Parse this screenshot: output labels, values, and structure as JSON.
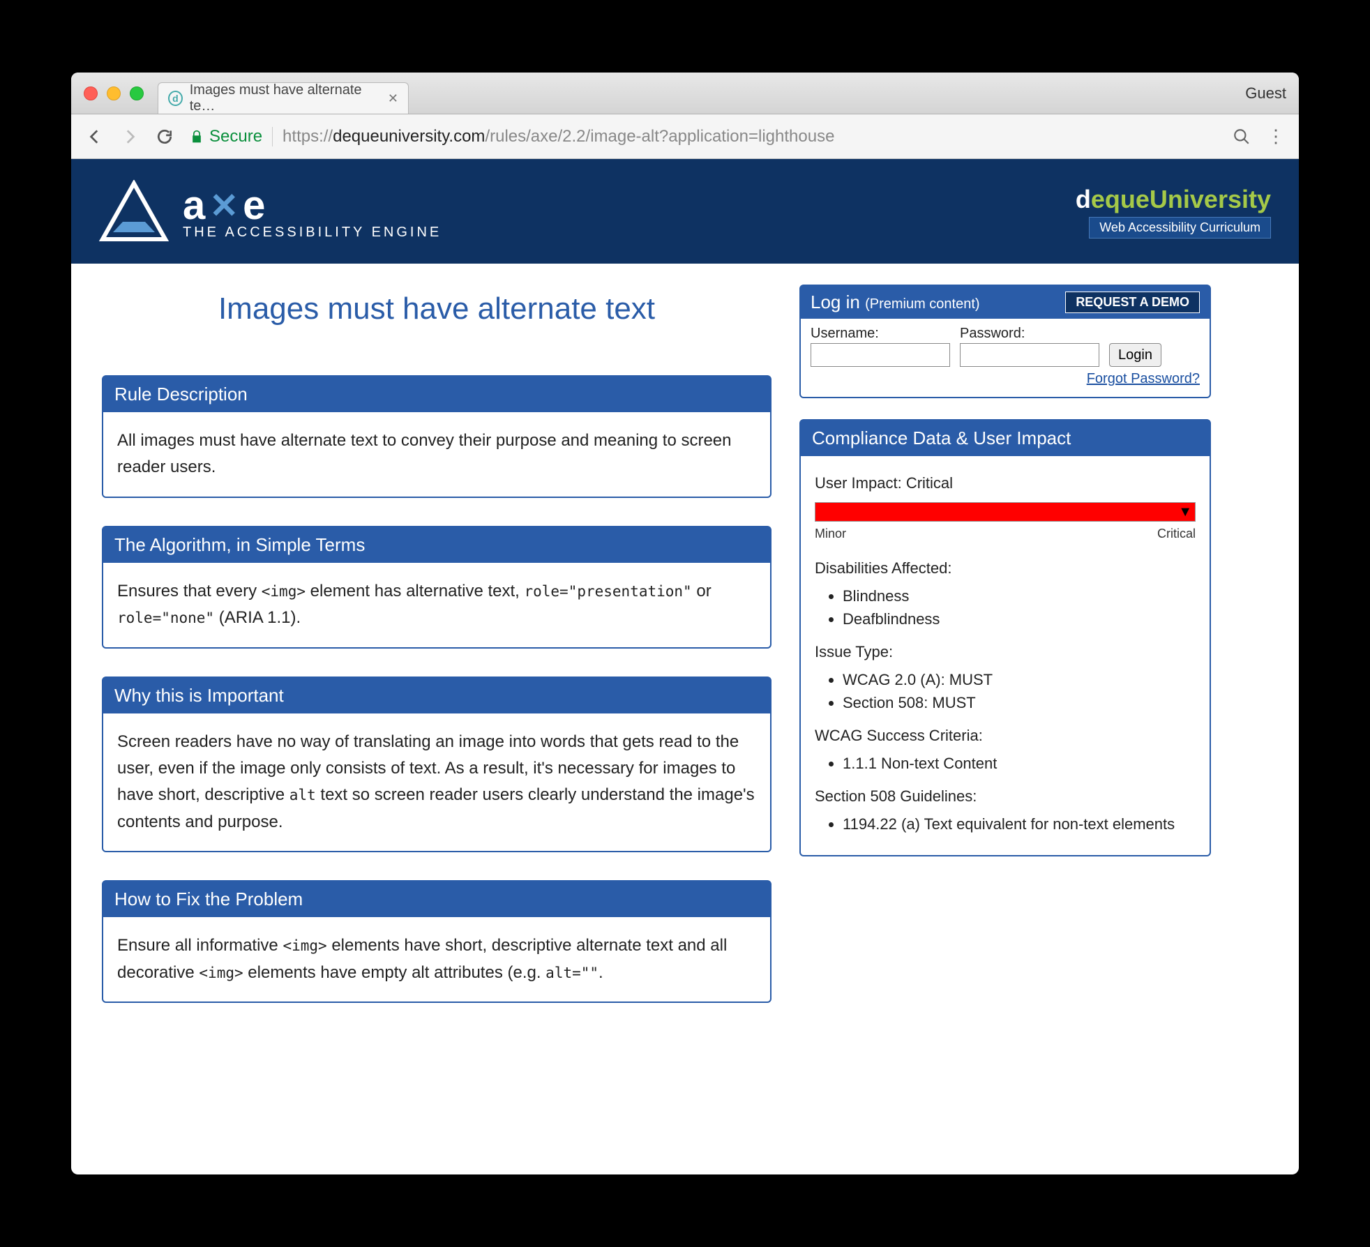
{
  "browser": {
    "tab_title": "Images must have alternate te…",
    "guest": "Guest",
    "secure_label": "Secure",
    "url_host": "https://",
    "url_domain": "dequeuniversity.com",
    "url_path": "/rules/axe/2.2/image-alt?application=lighthouse"
  },
  "brand": {
    "axe_word_a": "a",
    "axe_word_x": "✕",
    "axe_word_e": "e",
    "axe_tagline": "THE ACCESSIBILITY ENGINE",
    "deque_d": "d",
    "deque_rest": "eque",
    "deque_uni": "University",
    "deque_sub": "Web Accessibility Curriculum"
  },
  "login": {
    "title": "Log in",
    "subtitle": "(Premium content)",
    "demo": "REQUEST A DEMO",
    "username_label": "Username:",
    "password_label": "Password:",
    "login_btn": "Login",
    "forgot": "Forgot Password?"
  },
  "page_title": "Images must have alternate text",
  "sections": {
    "rule_desc": {
      "title": "Rule Description",
      "body": "All images must have alternate text to convey their purpose and meaning to screen reader users."
    },
    "algorithm": {
      "title": "The Algorithm, in Simple Terms",
      "body_pre": "Ensures that every ",
      "code1": "<img>",
      "body_mid": " element has alternative text, ",
      "code2": "role=\"presentation\"",
      "body_or": " or ",
      "code3": "role=\"none\"",
      "body_end": " (ARIA 1.1)."
    },
    "why": {
      "title": "Why this is Important",
      "body_pre": "Screen readers have no way of translating an image into words that gets read to the user, even if the image only consists of text. As a result, it's necessary for images to have short, descriptive ",
      "code1": "alt",
      "body_post": " text so screen reader users clearly understand the image's contents and purpose."
    },
    "fix": {
      "title": "How to Fix the Problem",
      "body_pre": "Ensure all informative ",
      "code1": "<img>",
      "body_mid": " elements have short, descriptive alternate text and all decorative ",
      "code2": "<img>",
      "body_mid2": " elements have empty alt attributes (e.g. ",
      "code3": "alt=\"\"",
      "body_end": "."
    }
  },
  "compliance": {
    "title": "Compliance Data & User Impact",
    "impact_label": "User Impact:",
    "impact_value": "Critical",
    "meter_min": "Minor",
    "meter_max": "Critical",
    "disabilities_label": "Disabilities Affected:",
    "disabilities": [
      "Blindness",
      "Deafblindness"
    ],
    "issue_type_label": "Issue Type:",
    "issue_types": [
      "WCAG 2.0 (A): MUST",
      "Section 508: MUST"
    ],
    "wcag_label": "WCAG Success Criteria:",
    "wcag": [
      "1.1.1 Non-text Content"
    ],
    "s508_label": "Section 508 Guidelines:",
    "s508": [
      "1194.22 (a) Text equivalent for non-text elements"
    ]
  }
}
